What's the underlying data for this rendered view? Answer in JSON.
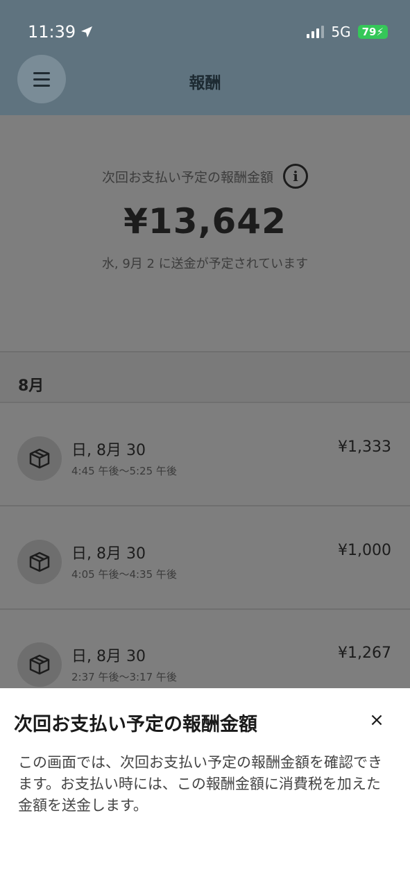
{
  "status_bar": {
    "time": "11:39",
    "network": "5G",
    "battery": "79"
  },
  "header": {
    "title": "報酬"
  },
  "summary": {
    "label": "次回お支払い予定の報酬金額",
    "amount": "¥13,642",
    "date_note": "水, 9月 2 に送金が予定されています"
  },
  "month": {
    "label": "8月"
  },
  "rows": [
    {
      "title": "日, 8月 30",
      "time": "4:45 午後〜5:25 午後",
      "amount": "¥1,333"
    },
    {
      "title": "日, 8月 30",
      "time": "4:05 午後〜4:35 午後",
      "amount": "¥1,000"
    },
    {
      "title": "日, 8月 30",
      "time": "2:37 午後〜3:17 午後",
      "amount": "¥1,267"
    }
  ],
  "sheet": {
    "title": "次回お支払い予定の報酬金額",
    "close": "×",
    "body": "この画面では、次回お支払い予定の報酬金額を確認できます。お支払い時には、この報酬金額に消費税を加えた金額を送金します。"
  },
  "icons": {
    "menu": "hamburger-menu-icon",
    "info": "info-icon",
    "package": "package-icon",
    "location": "location-arrow-icon"
  },
  "colors": {
    "header_bg": "#5f737f",
    "battery": "#35c759"
  }
}
